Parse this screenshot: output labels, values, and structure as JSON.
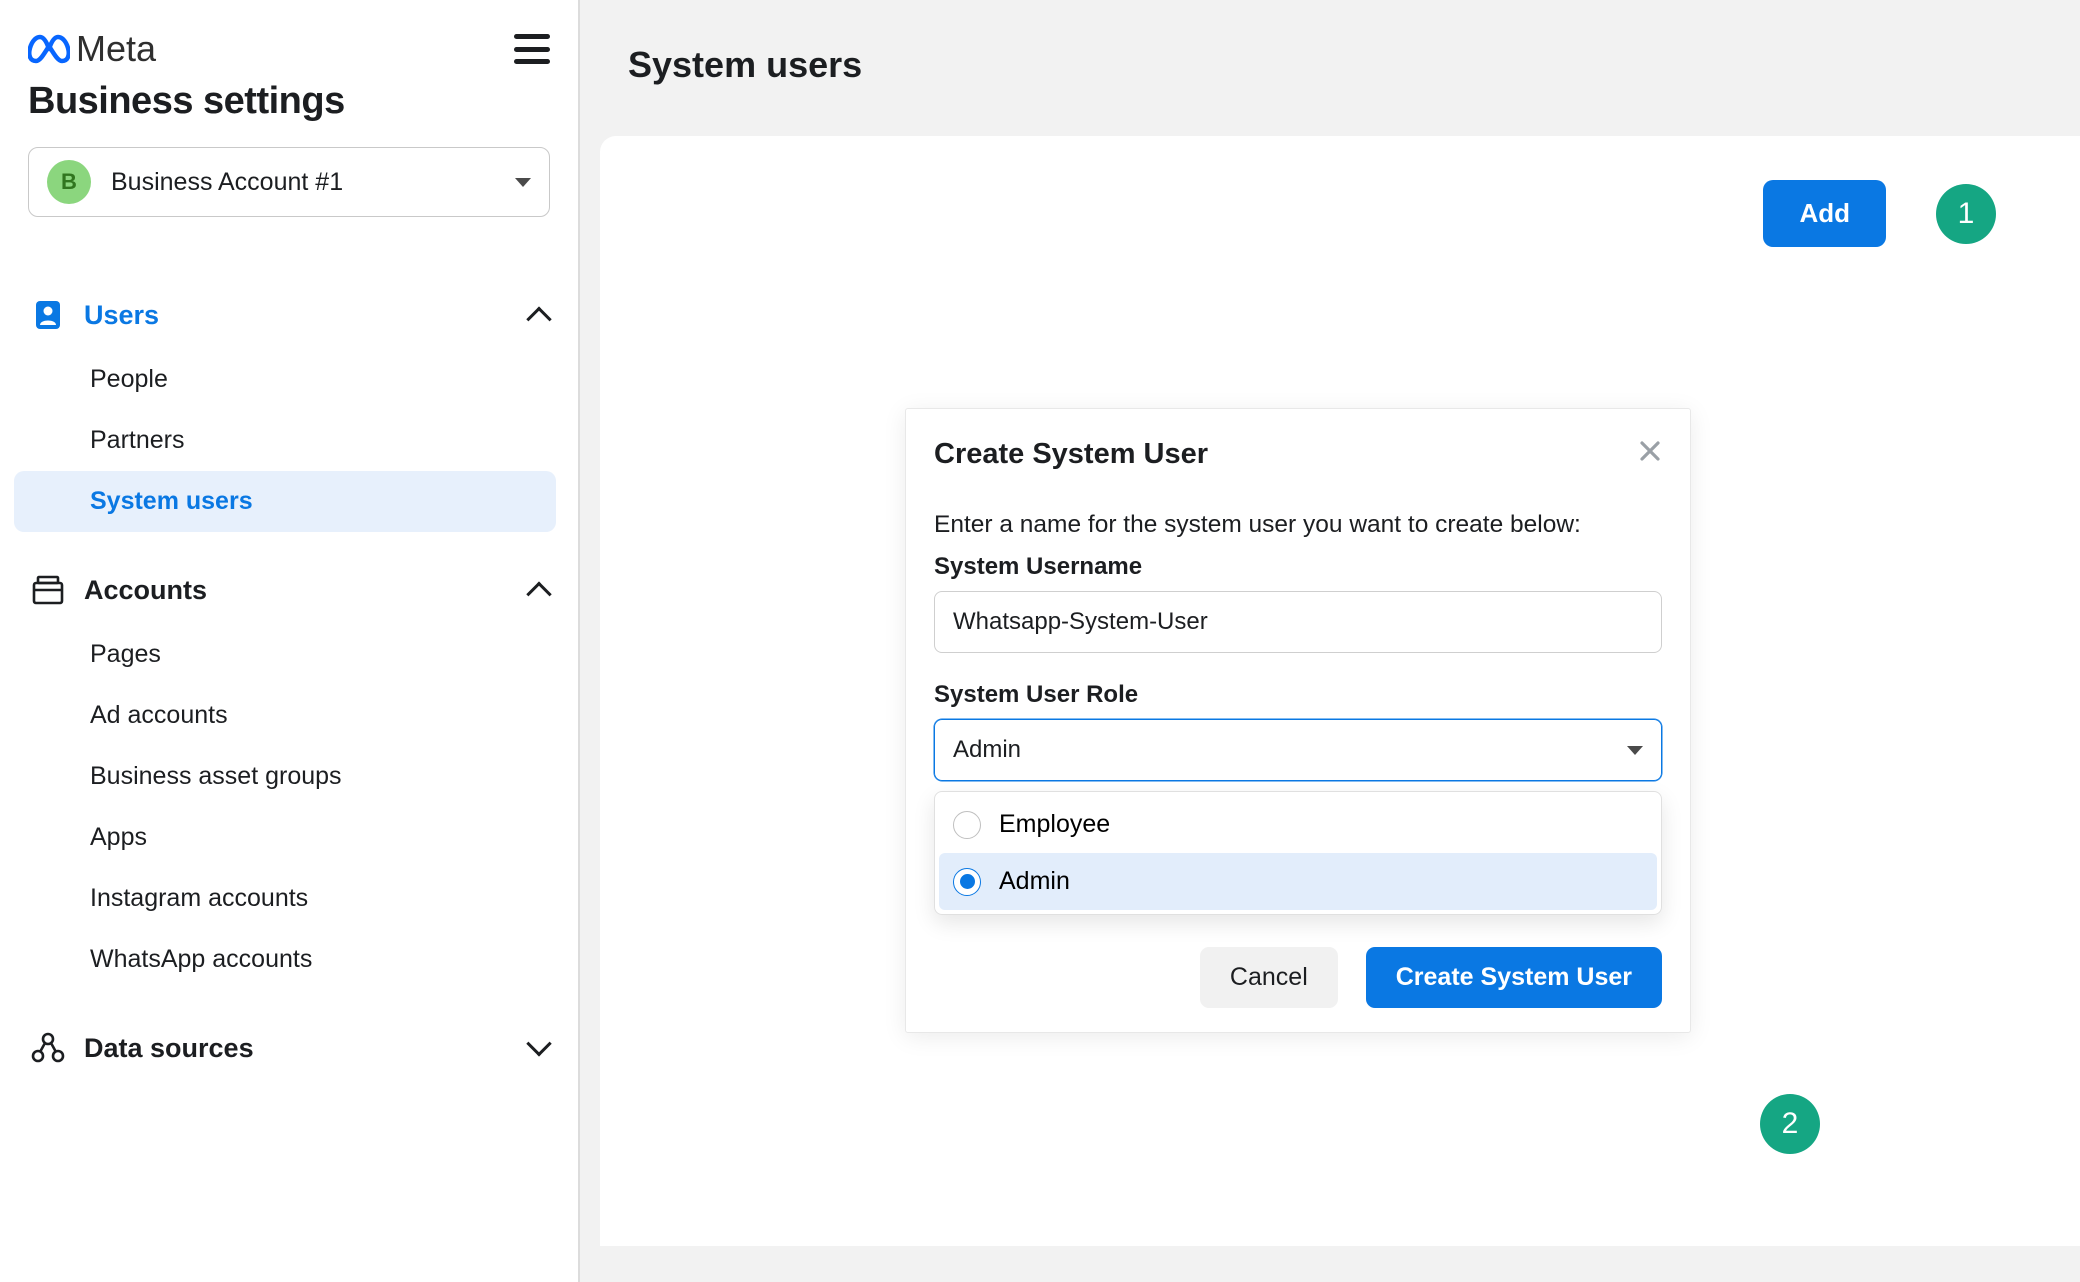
{
  "brand": {
    "name": "Meta"
  },
  "sidebar": {
    "title": "Business settings",
    "account": {
      "avatar_letter": "B",
      "name": "Business Account #1"
    },
    "groups": [
      {
        "key": "users",
        "label": "Users",
        "expanded": true,
        "active": true,
        "items": [
          {
            "label": "People"
          },
          {
            "label": "Partners"
          },
          {
            "label": "System users",
            "active": true
          }
        ]
      },
      {
        "key": "accounts",
        "label": "Accounts",
        "expanded": true,
        "items": [
          {
            "label": "Pages"
          },
          {
            "label": "Ad accounts"
          },
          {
            "label": "Business asset groups"
          },
          {
            "label": "Apps"
          },
          {
            "label": "Instagram accounts"
          },
          {
            "label": "WhatsApp accounts"
          }
        ]
      },
      {
        "key": "data_sources",
        "label": "Data sources",
        "expanded": false
      }
    ]
  },
  "page": {
    "title": "System users",
    "add_label": "Add",
    "step1": "1",
    "step2": "2"
  },
  "modal": {
    "title": "Create System User",
    "description": "Enter a name for the system user you want to create below:",
    "username_label": "System Username",
    "username_value": "Whatsapp-System-User",
    "role_label": "System User Role",
    "role_value": "Admin",
    "options": [
      {
        "label": "Employee",
        "selected": false
      },
      {
        "label": "Admin",
        "selected": true
      }
    ],
    "cancel_label": "Cancel",
    "submit_label": "Create System User"
  }
}
